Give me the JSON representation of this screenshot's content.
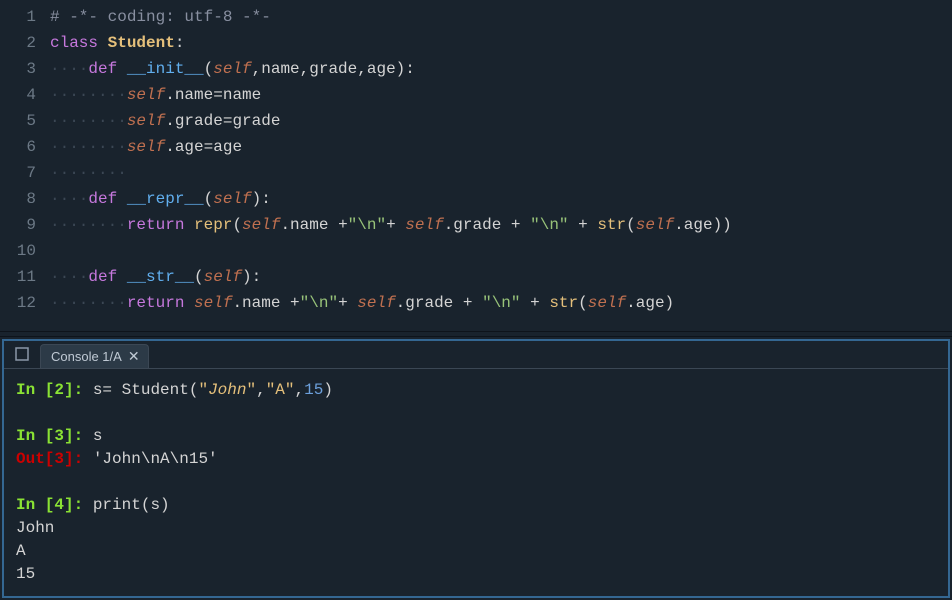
{
  "editor": {
    "lines": [
      {
        "n": "1",
        "tokens": [
          {
            "t": "# -*- coding: utf-8 -*-",
            "c": "c-comment"
          }
        ]
      },
      {
        "n": "2",
        "tokens": [
          {
            "t": "class ",
            "c": "c-kw"
          },
          {
            "t": "Student",
            "c": "c-class"
          },
          {
            "t": ":",
            "c": "c-punc"
          }
        ]
      },
      {
        "n": "3",
        "tokens": [
          {
            "t": "····",
            "c": "ws"
          },
          {
            "t": "def ",
            "c": "c-kw"
          },
          {
            "t": "__init__",
            "c": "c-def"
          },
          {
            "t": "(",
            "c": "c-punc"
          },
          {
            "t": "self",
            "c": "c-self"
          },
          {
            "t": ",name,grade,age):",
            "c": "c-param"
          }
        ]
      },
      {
        "n": "4",
        "tokens": [
          {
            "t": "········",
            "c": "ws"
          },
          {
            "t": "self",
            "c": "c-self"
          },
          {
            "t": ".name",
            "c": "c-punc"
          },
          {
            "t": "=",
            "c": "c-op"
          },
          {
            "t": "name",
            "c": "c-param"
          }
        ]
      },
      {
        "n": "5",
        "tokens": [
          {
            "t": "········",
            "c": "ws"
          },
          {
            "t": "self",
            "c": "c-self"
          },
          {
            "t": ".grade",
            "c": "c-punc"
          },
          {
            "t": "=",
            "c": "c-op"
          },
          {
            "t": "grade",
            "c": "c-param"
          }
        ]
      },
      {
        "n": "6",
        "tokens": [
          {
            "t": "········",
            "c": "ws"
          },
          {
            "t": "self",
            "c": "c-self"
          },
          {
            "t": ".age",
            "c": "c-punc"
          },
          {
            "t": "=",
            "c": "c-op"
          },
          {
            "t": "age",
            "c": "c-param"
          }
        ]
      },
      {
        "n": "7",
        "tokens": [
          {
            "t": "········",
            "c": "ws"
          }
        ]
      },
      {
        "n": "8",
        "tokens": [
          {
            "t": "····",
            "c": "ws"
          },
          {
            "t": "def ",
            "c": "c-kw"
          },
          {
            "t": "__repr__",
            "c": "c-def"
          },
          {
            "t": "(",
            "c": "c-punc"
          },
          {
            "t": "self",
            "c": "c-self"
          },
          {
            "t": "):",
            "c": "c-punc"
          }
        ]
      },
      {
        "n": "9",
        "tokens": [
          {
            "t": "········",
            "c": "ws"
          },
          {
            "t": "return ",
            "c": "c-kw"
          },
          {
            "t": "repr",
            "c": "c-builtin"
          },
          {
            "t": "(",
            "c": "c-punc"
          },
          {
            "t": "self",
            "c": "c-self"
          },
          {
            "t": ".name ",
            "c": "c-punc"
          },
          {
            "t": "+",
            "c": "c-op"
          },
          {
            "t": "\"\\n\"",
            "c": "c-str"
          },
          {
            "t": "+ ",
            "c": "c-op"
          },
          {
            "t": "self",
            "c": "c-self"
          },
          {
            "t": ".grade ",
            "c": "c-punc"
          },
          {
            "t": "+ ",
            "c": "c-op"
          },
          {
            "t": "\"\\n\"",
            "c": "c-str"
          },
          {
            "t": " + ",
            "c": "c-op"
          },
          {
            "t": "str",
            "c": "c-builtin"
          },
          {
            "t": "(",
            "c": "c-punc"
          },
          {
            "t": "self",
            "c": "c-self"
          },
          {
            "t": ".age))",
            "c": "c-punc"
          }
        ]
      },
      {
        "n": "10",
        "tokens": []
      },
      {
        "n": "11",
        "tokens": [
          {
            "t": "····",
            "c": "ws"
          },
          {
            "t": "def ",
            "c": "c-kw"
          },
          {
            "t": "__str__",
            "c": "c-def"
          },
          {
            "t": "(",
            "c": "c-punc"
          },
          {
            "t": "self",
            "c": "c-self"
          },
          {
            "t": "):",
            "c": "c-punc"
          }
        ]
      },
      {
        "n": "12",
        "tokens": [
          {
            "t": "········",
            "c": "ws"
          },
          {
            "t": "return ",
            "c": "c-kw"
          },
          {
            "t": "self",
            "c": "c-self"
          },
          {
            "t": ".name ",
            "c": "c-punc"
          },
          {
            "t": "+",
            "c": "c-op"
          },
          {
            "t": "\"\\n\"",
            "c": "c-str"
          },
          {
            "t": "+ ",
            "c": "c-op"
          },
          {
            "t": "self",
            "c": "c-self"
          },
          {
            "t": ".grade ",
            "c": "c-punc"
          },
          {
            "t": "+ ",
            "c": "c-op"
          },
          {
            "t": "\"\\n\"",
            "c": "c-str"
          },
          {
            "t": " + ",
            "c": "c-op"
          },
          {
            "t": "str",
            "c": "c-builtin"
          },
          {
            "t": "(",
            "c": "c-punc"
          },
          {
            "t": "self",
            "c": "c-self"
          },
          {
            "t": ".age)",
            "c": "c-punc"
          }
        ]
      }
    ]
  },
  "console": {
    "tab_label": "Console 1/A",
    "entries": [
      {
        "type": "in",
        "num": "2",
        "frags": [
          {
            "t": "s= Student(",
            "c": "con-text"
          },
          {
            "t": "\"",
            "c": "con-str"
          },
          {
            "t": "John",
            "c": "con-strit"
          },
          {
            "t": "\"",
            "c": "con-str"
          },
          {
            "t": ",",
            "c": "con-text"
          },
          {
            "t": "\"A\"",
            "c": "con-str"
          },
          {
            "t": ",",
            "c": "con-text"
          },
          {
            "t": "15",
            "c": "con-num-lit"
          },
          {
            "t": ")",
            "c": "con-text"
          }
        ]
      },
      {
        "type": "blank"
      },
      {
        "type": "in",
        "num": "3",
        "frags": [
          {
            "t": "s",
            "c": "con-text"
          }
        ]
      },
      {
        "type": "out",
        "num": "3",
        "frags": [
          {
            "t": "'John\\nA\\n15'",
            "c": "con-result"
          }
        ]
      },
      {
        "type": "blank"
      },
      {
        "type": "in",
        "num": "4",
        "frags": [
          {
            "t": "print",
            "c": "con-builtin"
          },
          {
            "t": "(s)",
            "c": "con-text"
          }
        ]
      },
      {
        "type": "plain",
        "frags": [
          {
            "t": "John",
            "c": "con-text"
          }
        ]
      },
      {
        "type": "plain",
        "frags": [
          {
            "t": "A",
            "c": "con-text"
          }
        ]
      },
      {
        "type": "plain",
        "frags": [
          {
            "t": "15",
            "c": "con-text"
          }
        ]
      }
    ]
  }
}
